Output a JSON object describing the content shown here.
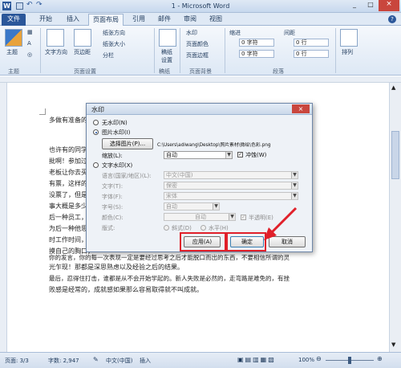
{
  "window": {
    "title": "1 - Microsoft Word",
    "controls": [
      "_",
      "□",
      "×"
    ]
  },
  "tabs": [
    "文件",
    "开始",
    "插入",
    "页面布局",
    "引用",
    "邮件",
    "审阅",
    "视图"
  ],
  "ribbon": {
    "theme": {
      "label": "主题",
      "group": "主题"
    },
    "page_setup": {
      "group": "页面设置",
      "text_direction": "文字方向",
      "margins": "页边距",
      "orientation": "纸张方向",
      "size": "纸张大小",
      "columns": "分栏"
    },
    "manuscript": {
      "label": "稿纸设置",
      "group": "稿纸"
    },
    "page_bg": {
      "group": "页面背景",
      "watermark": "水印",
      "page_color": "页面颜色",
      "page_border": "页面边框"
    },
    "paragraph": {
      "group": "段落",
      "indent": "缩进",
      "spacing": "间距",
      "left": "0 字符",
      "right": "0 字符",
      "before": "0 行",
      "after": "0 行"
    },
    "arrange": {
      "label": "排列"
    }
  },
  "document": {
    "lines": [
      "多做有准备的",
      "也许有的同学会",
      "批啊！参加过培",
      "老板让你去买水",
      "有票，这样的思",
      "没票了，但是可",
      "事大概是多少钱",
      "后一种员工，如",
      "为后一种他思考",
      "时工作时间，你",
      "摸自己的胸口，",
      "你的发言，你的每一次表现一定是要经过思考之后才能脱口而出的东西，不要相信所谓的灵",
      "光乍现！那都是深思熟虑以及经验之后的结果。",
      "最后，忍得住打击，谁都是从不会开始学起的。新人失败是必然的，走弯路是难免的，有挫",
      "败感是经常的，成就感如果那么容易取得就不叫成就。"
    ]
  },
  "dialog": {
    "title": "水印",
    "no_watermark": "无水印(N)",
    "picture_watermark": "图片水印(I)",
    "select_picture_btn": "选择图片(P)...",
    "picture_path": "C:\\Users\\adiwang\\Desktop\\照片素材\\微绘\\色彩.png",
    "scale_label": "缩放(L):",
    "scale_value": "自动",
    "washout": "冲蚀(W)",
    "text_watermark": "文字水印(X)",
    "language_label": "语言(国家/地区)(L):",
    "language_value": "中文(中国)",
    "text_label": "文字(T):",
    "text_value": "保密",
    "font_label": "字体(F):",
    "font_value": "宋体",
    "size_label": "字号(S):",
    "size_value": "自动",
    "color_label": "颜色(C):",
    "color_value": "自动",
    "semitransparent": "半透明(E)",
    "layout_label": "版式:",
    "diagonal": "斜式(D)",
    "horizontal": "水平(H)",
    "apply_btn": "应用(A)",
    "ok_btn": "确定",
    "cancel_btn": "取消"
  },
  "status": {
    "page": "页面: 3/3",
    "words": "字数: 2,947",
    "language": "中文(中国)",
    "mode": "插入",
    "zoom": "100%"
  },
  "colors": {
    "file_tab": "#2b579a",
    "highlight": "#e0202a"
  }
}
